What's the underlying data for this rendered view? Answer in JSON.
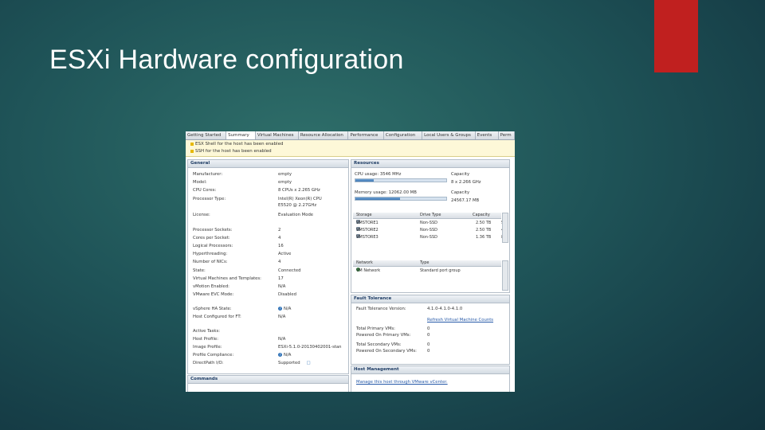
{
  "slide": {
    "title": "ESXi Hardware configuration"
  },
  "colors": {
    "accent": "#c0201f",
    "background": "#1f5458",
    "title_text": "#ffffff"
  },
  "tabs": [
    "Getting Started",
    "Summary",
    "Virtual Machines",
    "Resource Allocation",
    "Performance",
    "Configuration",
    "Local Users & Groups",
    "Events",
    "Perm"
  ],
  "active_tab": "Summary",
  "warnings": [
    "ESX Shell for the host has been enabled",
    "SSH for the host has been enabled"
  ],
  "general": {
    "title": "General",
    "rows": [
      {
        "k": "Manufacturer:",
        "v": "empty"
      },
      {
        "k": "Model:",
        "v": "empty"
      },
      {
        "k": "CPU Cores:",
        "v": "8 CPUs x 2.265 GHz"
      },
      {
        "k": "Processor Type:",
        "v": "Intel(R) Xeon(R) CPU"
      },
      {
        "k": "",
        "v": "E5520 @ 2.27GHz"
      },
      {
        "k": "License:",
        "v": "Evaluation Mode"
      },
      {
        "k": "Processor Sockets:",
        "v": "2"
      },
      {
        "k": "Cores per Socket:",
        "v": "4"
      },
      {
        "k": "Logical Processors:",
        "v": "16"
      },
      {
        "k": "Hyperthreading:",
        "v": "Active"
      },
      {
        "k": "Number of NICs:",
        "v": "4"
      },
      {
        "k": "State:",
        "v": "Connected"
      },
      {
        "k": "Virtual Machines and Templates:",
        "v": "17"
      },
      {
        "k": "vMotion Enabled:",
        "v": "N/A"
      },
      {
        "k": "VMware EVC Mode:",
        "v": "Disabled"
      },
      {
        "k": "vSphere HA State:",
        "v": "N/A"
      },
      {
        "k": "Host Configured for FT:",
        "v": "N/A"
      },
      {
        "k": "Active Tasks:",
        "v": ""
      },
      {
        "k": "Host Profile:",
        "v": "N/A"
      },
      {
        "k": "Image Profile:",
        "v": "ESXi-5.1.0-20130402001-stan"
      },
      {
        "k": "Profile Compliance:",
        "v": "N/A"
      },
      {
        "k": "DirectPath I/O:",
        "v": "Supported"
      }
    ]
  },
  "commands": {
    "title": "Commands"
  },
  "resources": {
    "title": "Resources",
    "cpu_label": "CPU usage: 3546 MHz",
    "cpu_capacity_label": "Capacity",
    "cpu_capacity_value": "8 x 2.266 GHz",
    "cpu_fraction": 0.2,
    "mem_label": "Memory usage: 12062.00 MB",
    "mem_capacity_label": "Capacity",
    "mem_capacity_value": "24567.17 MB",
    "mem_fraction": 0.49
  },
  "storage": {
    "headers": [
      "Storage",
      "Drive Type",
      "Capacity"
    ],
    "rows": [
      {
        "name": "VMSTORE1",
        "type": "Non-SSD",
        "cap": "2.50 TB",
        "extra": "50"
      },
      {
        "name": "VMSTORE2",
        "type": "Non-SSD",
        "cap": "2.50 TB",
        "extra": "49"
      },
      {
        "name": "VMSTORE3",
        "type": "Non-SSD",
        "cap": "1.36 TB",
        "extra": "84"
      }
    ]
  },
  "network": {
    "headers": [
      "Network",
      "Type"
    ],
    "rows": [
      {
        "name": "VM Network",
        "type": "Standard port group"
      }
    ]
  },
  "fault_tolerance": {
    "title": "Fault Tolerance",
    "version_label": "Fault Tolerance Version:",
    "version_value": "4.1.0-4.1.0-4.1.0",
    "refresh_link": "Refresh Virtual Machine Counts",
    "rows": [
      {
        "k": "Total Primary VMs:",
        "v": "0"
      },
      {
        "k": "Powered On Primary VMs:",
        "v": "0"
      },
      {
        "k": "Total Secondary VMs:",
        "v": "0"
      },
      {
        "k": "Powered On Secondary VMs:",
        "v": "0"
      }
    ]
  },
  "host_management": {
    "title": "Host Management",
    "link": "Manage this host through VMware vCenter."
  }
}
